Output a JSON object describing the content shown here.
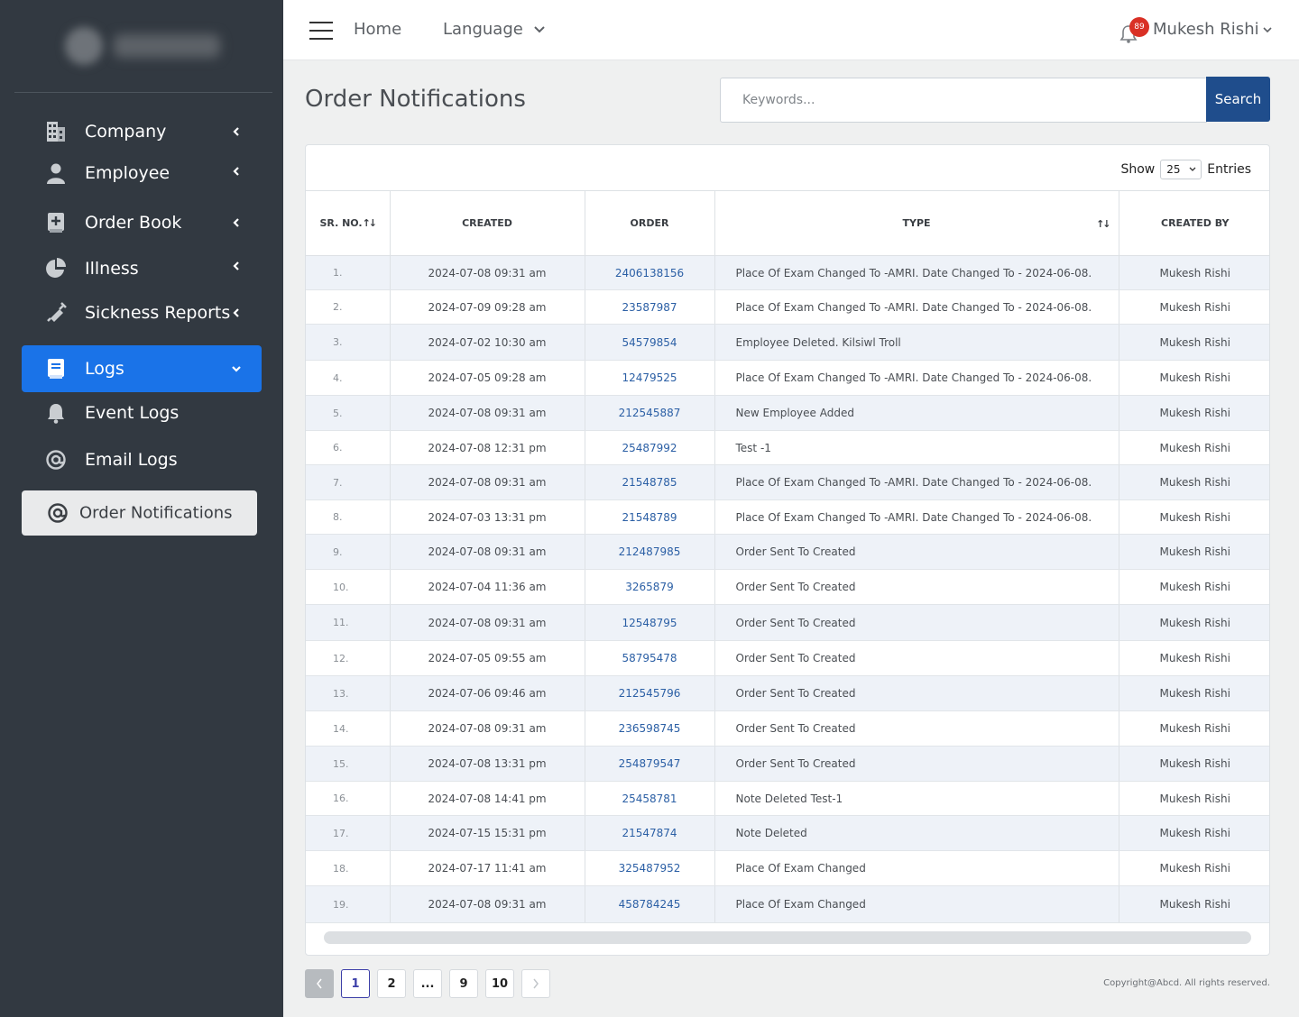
{
  "sidebar": {
    "items": [
      {
        "label": "Company",
        "icon": "building-icon"
      },
      {
        "label": "Employee",
        "icon": "user-icon"
      },
      {
        "label": "Order Book",
        "icon": "book-plus-icon"
      },
      {
        "label": "Illness",
        "icon": "pie-chart-icon"
      },
      {
        "label": "Sickness Reports",
        "icon": "syringe-icon"
      },
      {
        "label": "Logs",
        "icon": "book-icon"
      },
      {
        "label": "Event Logs",
        "icon": "bell-icon"
      },
      {
        "label": "Email Logs",
        "icon": "at-icon"
      },
      {
        "label": "Order Notifications",
        "icon": "at-icon"
      }
    ]
  },
  "topbar": {
    "home": "Home",
    "language": "Language",
    "notification_count": "89",
    "user_name": "Mukesh Rishi"
  },
  "page": {
    "title": "Order Notifications"
  },
  "search": {
    "placeholder": "Keywords...",
    "button": "Search"
  },
  "table": {
    "show_label": "Show",
    "entries_value": "25",
    "entries_label": "Entries",
    "columns": [
      "SR. NO.",
      "CREATED",
      "ORDER",
      "TYPE",
      "CREATED BY"
    ],
    "rows": [
      {
        "sr": "1.",
        "created": "2024-07-08 09:31 am",
        "order": "2406138156",
        "type": "Place Of Exam Changed To -AMRI. Date Changed To - 2024-06-08.",
        "by": "Mukesh Rishi"
      },
      {
        "sr": "2.",
        "created": "2024-07-09 09:28 am",
        "order": "23587987",
        "type": "Place Of Exam Changed To -AMRI. Date Changed To - 2024-06-08.",
        "by": "Mukesh Rishi"
      },
      {
        "sr": "3.",
        "created": "2024-07-02 10:30 am",
        "order": "54579854",
        "type": "Employee Deleted. Kilsiwl Troll",
        "by": "Mukesh Rishi"
      },
      {
        "sr": "4.",
        "created": "2024-07-05 09:28 am",
        "order": "12479525",
        "type": "Place Of Exam Changed To -AMRI. Date Changed To - 2024-06-08.",
        "by": "Mukesh Rishi"
      },
      {
        "sr": "5.",
        "created": "2024-07-08 09:31 am",
        "order": "212545887",
        "type": "New Employee Added",
        "by": "Mukesh Rishi"
      },
      {
        "sr": "6.",
        "created": "2024-07-08 12:31 pm",
        "order": "25487992",
        "type": "Test -1",
        "by": "Mukesh Rishi"
      },
      {
        "sr": "7.",
        "created": "2024-07-08 09:31 am",
        "order": "21548785",
        "type": "Place Of Exam Changed To -AMRI. Date Changed To - 2024-06-08.",
        "by": "Mukesh Rishi"
      },
      {
        "sr": "8.",
        "created": "2024-07-03 13:31 pm",
        "order": "21548789",
        "type": "Place Of Exam Changed To -AMRI. Date Changed To - 2024-06-08.",
        "by": "Mukesh Rishi"
      },
      {
        "sr": "9.",
        "created": "2024-07-08 09:31 am",
        "order": "212487985",
        "type": "Order Sent To Created",
        "by": "Mukesh Rishi"
      },
      {
        "sr": "10.",
        "created": "2024-07-04 11:36 am",
        "order": "3265879",
        "type": "Order Sent To Created",
        "by": "Mukesh Rishi"
      },
      {
        "sr": "11.",
        "created": "2024-07-08 09:31 am",
        "order": "12548795",
        "type": "Order Sent To Created",
        "by": "Mukesh Rishi"
      },
      {
        "sr": "12.",
        "created": "2024-07-05 09:55 am",
        "order": "58795478",
        "type": "Order Sent To Created",
        "by": "Mukesh Rishi"
      },
      {
        "sr": "13.",
        "created": "2024-07-06 09:46 am",
        "order": "212545796",
        "type": "Order Sent To Created",
        "by": "Mukesh Rishi"
      },
      {
        "sr": "14.",
        "created": "2024-07-08 09:31 am",
        "order": "236598745",
        "type": "Order Sent To Created",
        "by": "Mukesh Rishi"
      },
      {
        "sr": "15.",
        "created": "2024-07-08 13:31 pm",
        "order": "254879547",
        "type": "Order Sent To Created",
        "by": "Mukesh Rishi"
      },
      {
        "sr": "16.",
        "created": "2024-07-08 14:41 pm",
        "order": "25458781",
        "type": "Note Deleted Test-1",
        "by": "Mukesh Rishi"
      },
      {
        "sr": "17.",
        "created": "2024-07-15 15:31 pm",
        "order": "21547874",
        "type": "Note Deleted",
        "by": "Mukesh Rishi"
      },
      {
        "sr": "18.",
        "created": "2024-07-17 11:41 am",
        "order": "325487952",
        "type": "Place Of Exam Changed",
        "by": "Mukesh Rishi"
      },
      {
        "sr": "19.",
        "created": "2024-07-08 09:31 am",
        "order": "458784245",
        "type": "Place Of Exam Changed",
        "by": "Mukesh Rishi"
      }
    ]
  },
  "pagination": {
    "pages": [
      "1",
      "2",
      "...",
      "9",
      "10"
    ],
    "current": "1"
  },
  "footer": {
    "copyright": "Copyright@Abcd. All rights reserved."
  },
  "colors": {
    "sidebar_bg": "#323941",
    "active_nav": "#1a73e8",
    "search_button": "#1f4d8c",
    "badge": "#d93025",
    "link": "#2b5fa5"
  }
}
